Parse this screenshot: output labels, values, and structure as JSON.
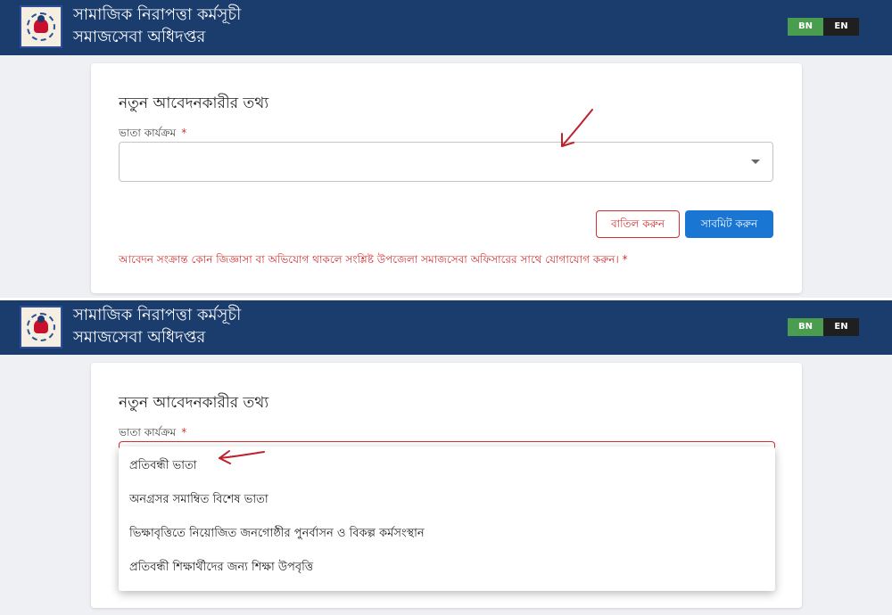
{
  "header": {
    "title_line1": "সামাজিক নিরাপত্তা কর্মসূচী",
    "title_line2": "সমাজসেবা অধিদপ্তর",
    "lang_bn": "BN",
    "lang_en": "EN",
    "logo_icon": "department-of-social-services-logo"
  },
  "form": {
    "title": "নতুন আবেদনকারীর তথ্য",
    "field_label": "ভাতা কার্যক্রম",
    "required_mark": "*",
    "cancel_label": "বাতিল করুন",
    "submit_label": "সাবমিট করুন",
    "notice": "আবেদন সংক্রান্ত কোন জিজ্ঞাসা বা অভিযোগ থাকলে সংশ্লিষ্ট উপজেলা সমাজসেবা অফিসারের সাথে যোগাযোগ করুন। *"
  },
  "dropdown": {
    "options": [
      "প্রতিবন্ধী ভাতা",
      "অনগ্রসর সমাম্বিত বিশেষ ভাতা",
      "ভিক্ষাবৃত্তিতে নিয়োজিত জনগোষ্ঠীর পুনর্বাসন ও বিকল্প কর্মসংস্থান",
      "প্রতিবন্ধী শিক্ষার্থীদের জন্য শিক্ষা উপবৃত্তি"
    ]
  },
  "colors": {
    "header_bg": "#1b3d6e",
    "accent_red": "#d32f2f",
    "submit_blue": "#1976d2",
    "lang_active": "#4a9d4e"
  }
}
